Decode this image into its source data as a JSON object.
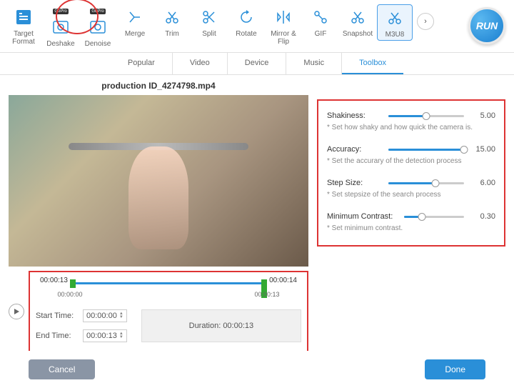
{
  "toolbar": {
    "items": [
      {
        "label": "Target Format",
        "icon": "target"
      },
      {
        "label": "Deshake",
        "icon": "deshake",
        "gopro": true
      },
      {
        "label": "Denoise",
        "icon": "denoise",
        "gopro": true
      },
      {
        "label": "Merge",
        "icon": "merge"
      },
      {
        "label": "Trim",
        "icon": "trim"
      },
      {
        "label": "Split",
        "icon": "split"
      },
      {
        "label": "Rotate",
        "icon": "rotate"
      },
      {
        "label": "Mirror & Flip",
        "icon": "mirror"
      },
      {
        "label": "GIF",
        "icon": "gif"
      },
      {
        "label": "Snapshot",
        "icon": "snapshot"
      },
      {
        "label": "M3U8",
        "icon": "m3u8"
      }
    ],
    "gopro_badge": "GoPro",
    "run_label": "RUN"
  },
  "tabs": [
    "Popular",
    "Video",
    "Device",
    "Music",
    "Toolbox"
  ],
  "video": {
    "title": "production ID_4274798.mp4"
  },
  "timeline": {
    "in_time": "00:00:13",
    "out_time": "00:00:14",
    "sub_left": "00:00:00",
    "sub_right": "00:00:13",
    "start_label": "Start Time:",
    "end_label": "End Time:",
    "start_value": "00:00:00",
    "end_value": "00:00:13",
    "duration_label": "Duration:  00:00:13"
  },
  "settings": {
    "shakiness": {
      "label": "Shakiness:",
      "value": "5.00",
      "hint": "* Set how shaky and how quick the camera is.",
      "fill": 50
    },
    "accuracy": {
      "label": "Accuracy:",
      "value": "15.00",
      "hint": "* Set the accurary of the detection process",
      "fill": 100
    },
    "stepsize": {
      "label": "Step Size:",
      "value": "6.00",
      "hint": "* Set stepsize of the search process",
      "fill": 62
    },
    "contrast": {
      "label": "Minimum Contrast:",
      "value": "0.30",
      "hint": "* Set minimum contrast.",
      "fill": 30
    }
  },
  "footer": {
    "cancel": "Cancel",
    "done": "Done"
  }
}
